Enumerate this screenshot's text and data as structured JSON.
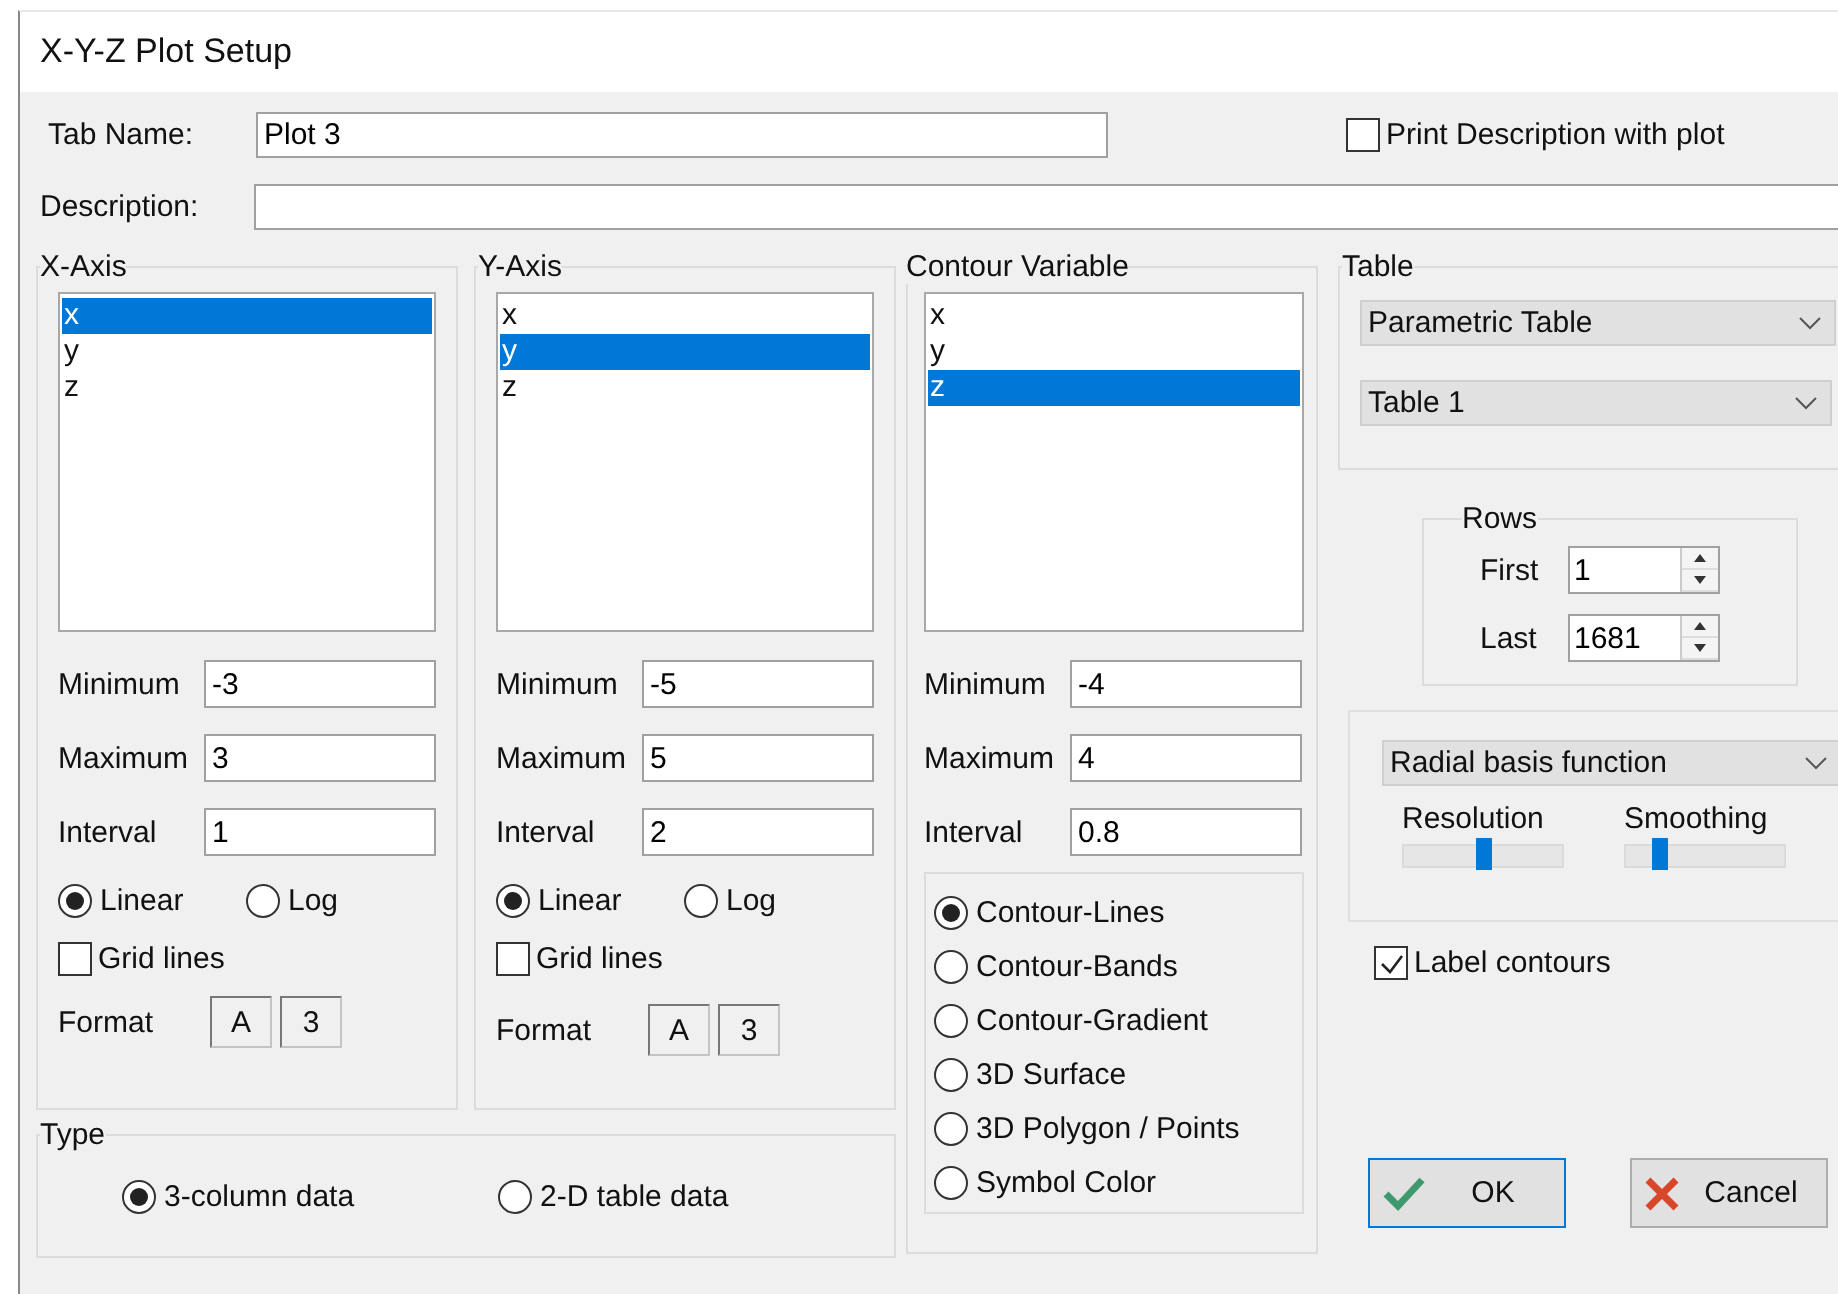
{
  "window": {
    "title": "X-Y-Z Plot Setup"
  },
  "tab_name": {
    "label": "Tab Name:",
    "value": "Plot 3"
  },
  "print_description": {
    "label": "Print Description with plot",
    "checked": false
  },
  "description": {
    "label": "Description:"
  },
  "axes": [
    {
      "title": "X-Axis",
      "variables": [
        {
          "label": "x",
          "selected": true
        },
        {
          "label": "y",
          "selected": false
        },
        {
          "label": "z",
          "selected": false
        }
      ],
      "fields": [
        {
          "label": "Minimum",
          "value": "-3"
        },
        {
          "label": "Maximum",
          "value": "3"
        },
        {
          "label": "Interval",
          "value": "1"
        }
      ],
      "scales": [
        {
          "label": "Linear",
          "selected": true
        },
        {
          "label": "Log",
          "selected": false
        }
      ],
      "grid_lines": {
        "label": "Grid lines",
        "checked": false
      },
      "format": {
        "label": "Format",
        "buttons": [
          "A",
          "3"
        ]
      }
    },
    {
      "title": "Y-Axis",
      "variables": [
        {
          "label": "x",
          "selected": false
        },
        {
          "label": "y",
          "selected": true
        },
        {
          "label": "z",
          "selected": false
        }
      ],
      "fields": [
        {
          "label": "Minimum",
          "value": "-5"
        },
        {
          "label": "Maximum",
          "value": "5"
        },
        {
          "label": "Interval",
          "value": "2"
        }
      ],
      "scales": [
        {
          "label": "Linear",
          "selected": true
        },
        {
          "label": "Log",
          "selected": false
        }
      ],
      "grid_lines": {
        "label": "Grid lines",
        "checked": false
      },
      "format": {
        "label": "Format",
        "buttons": [
          "A",
          "3"
        ]
      }
    }
  ],
  "contour": {
    "title": "Contour Variable",
    "variables": [
      {
        "label": "x",
        "selected": false
      },
      {
        "label": "y",
        "selected": false
      },
      {
        "label": "z",
        "selected": true
      }
    ],
    "fields": [
      {
        "label": "Minimum",
        "value": "-4"
      },
      {
        "label": "Maximum",
        "value": "4"
      },
      {
        "label": "Interval",
        "value": "0.8"
      }
    ],
    "styles": [
      {
        "label": "Contour-Lines",
        "selected": true
      },
      {
        "label": "Contour-Bands",
        "selected": false
      },
      {
        "label": "Contour-Gradient",
        "selected": false
      },
      {
        "label": "3D Surface",
        "selected": false
      },
      {
        "label": "3D Polygon / Points",
        "selected": false
      },
      {
        "label": "Symbol Color",
        "selected": false
      }
    ]
  },
  "type": {
    "title": "Type",
    "options": [
      {
        "label": "3-column data",
        "selected": true
      },
      {
        "label": "2-D table data",
        "selected": false
      }
    ]
  },
  "table": {
    "title": "Table",
    "selects": [
      "Parametric Table",
      "Table 1"
    ]
  },
  "rows": {
    "title": "Rows",
    "fields": [
      {
        "label": "First",
        "value": "1"
      },
      {
        "label": "Last",
        "value": "1681"
      }
    ]
  },
  "interpolation": {
    "method": "Radial basis function",
    "sliders": [
      {
        "label": "Resolution",
        "level": 0.5
      },
      {
        "label": "Smoothing",
        "level": 0.22
      }
    ]
  },
  "label_contours": {
    "label": "Label contours",
    "checked": true
  },
  "buttons": [
    {
      "label": "OK",
      "kind": "ok",
      "default": true
    },
    {
      "label": "Cancel",
      "kind": "cancel",
      "default": false
    }
  ]
}
